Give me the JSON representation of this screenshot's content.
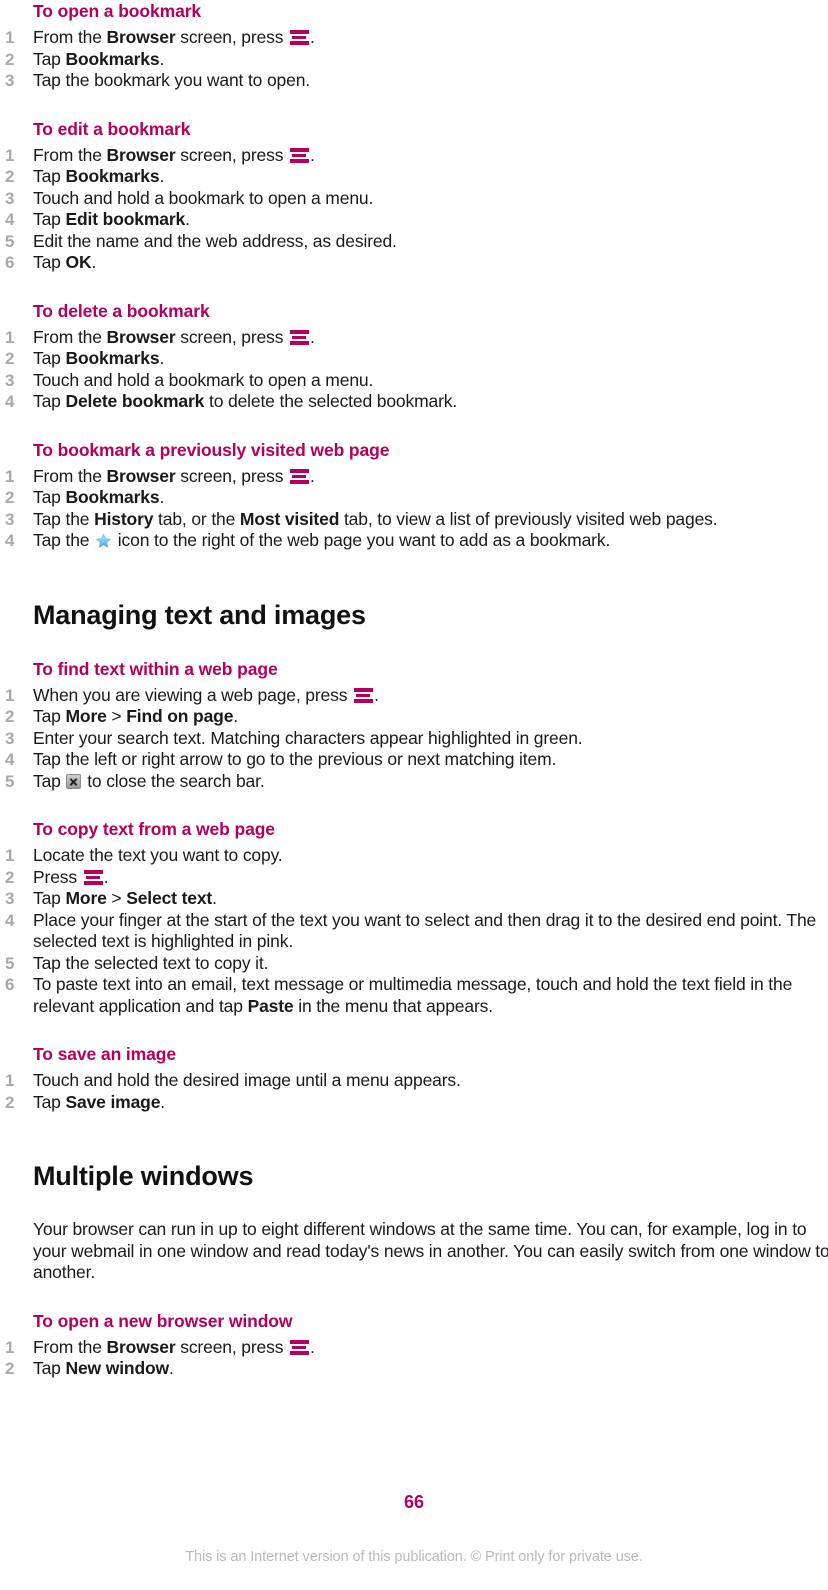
{
  "colors": {
    "heading_magenta": "#b4005a",
    "body_text": "#1a1a1a",
    "list_number": "#a8a8a8",
    "footer_gray": "#b9b9b9"
  },
  "sections": [
    {
      "id": "to-open-a-bookmark",
      "heading": "To open a bookmark",
      "steps": [
        {
          "n": "1",
          "pre": "From the ",
          "bold": "Browser",
          "mid": " screen, press ",
          "icon": "menu-icon",
          "post": "."
        },
        {
          "n": "2",
          "pre": "Tap ",
          "bold": "Bookmarks",
          "post": "."
        },
        {
          "n": "3",
          "pre": "Tap the bookmark you want to open."
        }
      ]
    },
    {
      "id": "to-edit-a-bookmark",
      "heading": "To edit a bookmark",
      "steps": [
        {
          "n": "1",
          "pre": "From the ",
          "bold": "Browser",
          "mid": " screen, press ",
          "icon": "menu-icon",
          "post": "."
        },
        {
          "n": "2",
          "pre": "Tap ",
          "bold": "Bookmarks",
          "post": "."
        },
        {
          "n": "3",
          "pre": "Touch and hold a bookmark to open a menu."
        },
        {
          "n": "4",
          "pre": "Tap ",
          "bold": "Edit bookmark",
          "post": "."
        },
        {
          "n": "5",
          "pre": "Edit the name and the web address, as desired."
        },
        {
          "n": "6",
          "pre": "Tap ",
          "bold": "OK",
          "post": "."
        }
      ]
    },
    {
      "id": "to-delete-a-bookmark",
      "heading": "To delete a bookmark",
      "steps": [
        {
          "n": "1",
          "pre": "From the ",
          "bold": "Browser",
          "mid": " screen, press ",
          "icon": "menu-icon",
          "post": "."
        },
        {
          "n": "2",
          "pre": "Tap ",
          "bold": "Bookmarks",
          "post": "."
        },
        {
          "n": "3",
          "pre": "Touch and hold a bookmark to open a menu."
        },
        {
          "n": "4",
          "pre": "Tap ",
          "bold": "Delete bookmark",
          "post": " to delete the selected bookmark."
        }
      ]
    },
    {
      "id": "to-bookmark-previously-visited",
      "heading": "To bookmark a previously visited web page",
      "steps": [
        {
          "n": "1",
          "pre": "From the ",
          "bold": "Browser",
          "mid": " screen, press ",
          "icon": "menu-icon",
          "post": "."
        },
        {
          "n": "2",
          "pre": "Tap ",
          "bold": "Bookmarks",
          "post": "."
        },
        {
          "n": "3",
          "pre": "Tap the ",
          "bold": "History",
          "mid": " tab, or the ",
          "bold2": "Most visited",
          "post": " tab, to view a list of previously visited web pages."
        },
        {
          "n": "4",
          "pre": "Tap the ",
          "icon": "star-icon",
          "post": " icon to the right of the web page you want to add as a bookmark."
        }
      ]
    }
  ],
  "chapter_managing": {
    "title": "Managing text and images",
    "sections": [
      {
        "id": "to-find-text",
        "heading": "To find text within a web page",
        "steps": [
          {
            "n": "1",
            "pre": "When you are viewing a web page, press ",
            "icon": "menu-icon",
            "post": "."
          },
          {
            "n": "2",
            "pre": "Tap ",
            "bold": "More",
            "mid": " > ",
            "bold2": "Find on page",
            "post": "."
          },
          {
            "n": "3",
            "pre": "Enter your search text. Matching characters appear highlighted in green."
          },
          {
            "n": "4",
            "pre": "Tap the left or right arrow to go to the previous or next matching item."
          },
          {
            "n": "5",
            "pre": "Tap ",
            "icon": "close-icon",
            "post": " to close the search bar."
          }
        ]
      },
      {
        "id": "to-copy-text",
        "heading": "To copy text from a web page",
        "steps": [
          {
            "n": "1",
            "pre": "Locate the text you want to copy."
          },
          {
            "n": "2",
            "pre": "Press ",
            "icon": "menu-icon",
            "post": "."
          },
          {
            "n": "3",
            "pre": "Tap ",
            "bold": "More",
            "mid": " > ",
            "bold2": "Select text",
            "post": "."
          },
          {
            "n": "4",
            "pre": "Place your finger at the start of the text you want to select and then drag it to the desired end point. The selected text is highlighted in pink."
          },
          {
            "n": "5",
            "pre": "Tap the selected text to copy it."
          },
          {
            "n": "6",
            "pre": "To paste text into an email, text message or multimedia message, touch and hold the text field in the relevant application and tap ",
            "bold": "Paste",
            "post": " in the menu that appears."
          }
        ]
      },
      {
        "id": "to-save-an-image",
        "heading": "To save an image",
        "steps": [
          {
            "n": "1",
            "pre": "Touch and hold the desired image until a menu appears."
          },
          {
            "n": "2",
            "pre": "Tap ",
            "bold": "Save image",
            "post": "."
          }
        ]
      }
    ]
  },
  "chapter_multiple": {
    "title": "Multiple windows",
    "paragraph": "Your browser can run in up to eight different windows at the same time. You can, for example, log in to your webmail in one window and read today's news in another. You can easily switch from one window to another.",
    "sections": [
      {
        "id": "to-open-new-browser-window",
        "heading": "To open a new browser window",
        "steps": [
          {
            "n": "1",
            "pre": "From the ",
            "bold": "Browser",
            "mid": " screen, press ",
            "icon": "menu-icon",
            "post": "."
          },
          {
            "n": "2",
            "pre": "Tap ",
            "bold": "New window",
            "post": "."
          }
        ]
      }
    ]
  },
  "footer": {
    "page_number": "66",
    "note": "This is an Internet version of this publication. © Print only for private use."
  }
}
